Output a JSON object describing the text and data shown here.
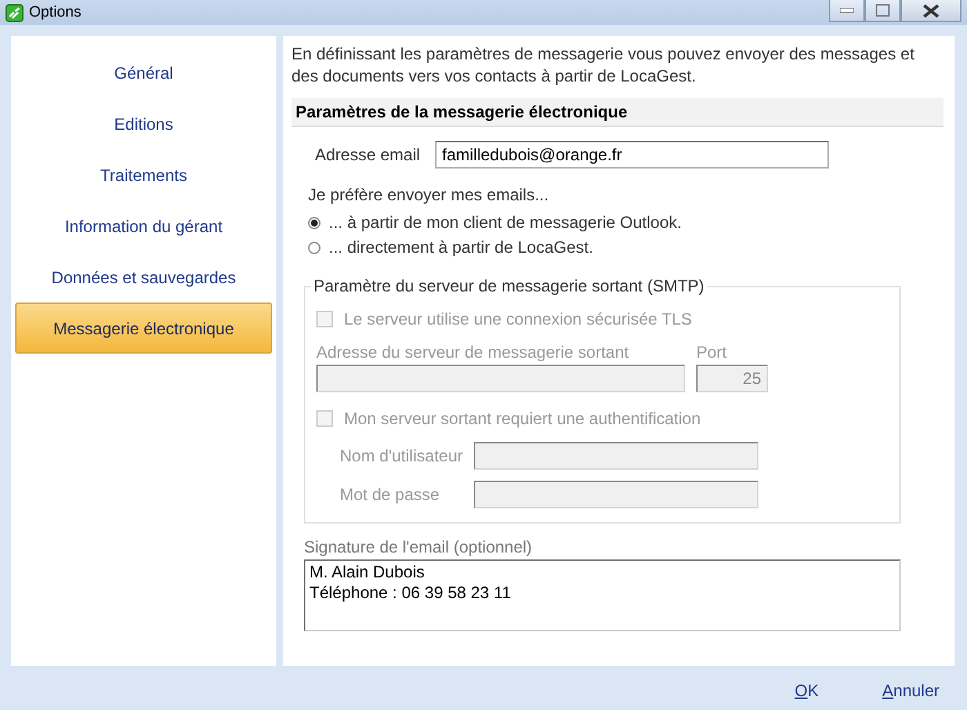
{
  "window": {
    "title": "Options"
  },
  "sidebar": {
    "items": [
      {
        "label": "Général",
        "selected": false
      },
      {
        "label": "Editions",
        "selected": false
      },
      {
        "label": "Traitements",
        "selected": false
      },
      {
        "label": "Information du gérant",
        "selected": false
      },
      {
        "label": "Données et sauvegardes",
        "selected": false
      },
      {
        "label": "Messagerie électronique",
        "selected": true
      }
    ]
  },
  "intro": "En définissant les paramètres de messagerie vous pouvez envoyer des messages et des documents vers vos contacts à partir de LocaGest.",
  "section_title": "Paramètres de la messagerie électronique",
  "email": {
    "label": "Adresse email",
    "value": "familledubois@orange.fr"
  },
  "preference": {
    "label": "Je préfère envoyer mes emails...",
    "options": [
      {
        "label": "... à partir de mon client de messagerie Outlook.",
        "selected": true
      },
      {
        "label": "... directement à partir de LocaGest.",
        "selected": false
      }
    ]
  },
  "smtp": {
    "legend": "Paramètre du serveur de messagerie sortant (SMTP)",
    "disabled": true,
    "tls": {
      "label": "Le serveur utilise une connexion sécurisée TLS",
      "checked": false
    },
    "server": {
      "label": "Adresse du serveur de messagerie sortant"
    },
    "port": {
      "label": "Port",
      "value": "25"
    },
    "auth": {
      "label": "Mon serveur sortant requiert une authentification",
      "checked": false
    },
    "username": {
      "label": "Nom d'utilisateur"
    },
    "password": {
      "label": "Mot de passe"
    }
  },
  "signature": {
    "label": "Signature de l'email (optionnel)",
    "value": "M. Alain Dubois\nTéléphone : 06 39 58 23 11"
  },
  "buttons": [
    {
      "label": "OK"
    },
    {
      "label": "Annuler"
    }
  ]
}
